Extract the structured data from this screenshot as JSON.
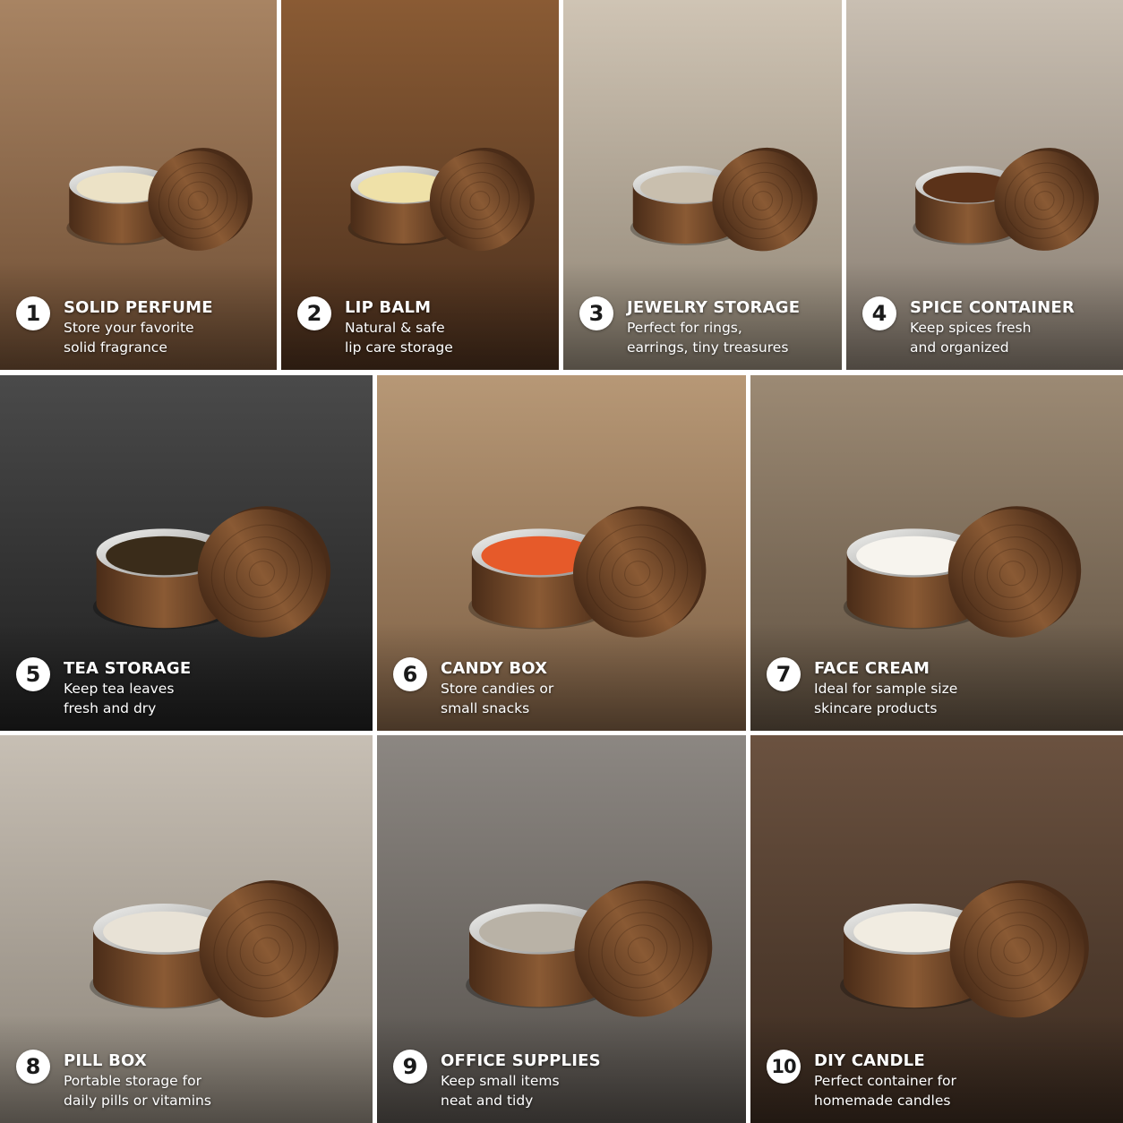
{
  "tiles": [
    {
      "number": "1",
      "title": "SOLID PERFUME",
      "line1": "Store your favorite",
      "line2": "solid fragrance",
      "colors": {
        "bg1": "#a88463",
        "bg2": "#6e4d33",
        "fill": "#ece2c6"
      }
    },
    {
      "number": "2",
      "title": "LIP BALM",
      "line1": "Natural & safe",
      "line2": "lip care storage",
      "colors": {
        "bg1": "#8a5b34",
        "bg2": "#4a2f1d",
        "fill": "#efe1a8"
      }
    },
    {
      "number": "3",
      "title": "JEWELRY STORAGE",
      "line1": "Perfect for rings,",
      "line2": "earrings, tiny treasures",
      "colors": {
        "bg1": "#cfc4b4",
        "bg2": "#8f8474",
        "fill": "#c9bfae"
      }
    },
    {
      "number": "4",
      "title": "SPICE CONTAINER",
      "line1": "Keep spices fresh",
      "line2": "and organized",
      "colors": {
        "bg1": "#c9bfb2",
        "bg2": "#857a6e",
        "fill": "#5b3219"
      }
    },
    {
      "number": "5",
      "title": "TEA STORAGE",
      "line1": "Keep tea leaves",
      "line2": "fresh and dry",
      "colors": {
        "bg1": "#4a4a4a",
        "bg2": "#1f1f1f",
        "fill": "#3a2c1a"
      }
    },
    {
      "number": "6",
      "title": "CANDY BOX",
      "line1": "Store candies or",
      "line2": "small snacks",
      "colors": {
        "bg1": "#b79876",
        "bg2": "#7c5e43",
        "fill": "#e65a2a"
      }
    },
    {
      "number": "7",
      "title": "FACE CREAM",
      "line1": "Ideal for sample size",
      "line2": "skincare products",
      "colors": {
        "bg1": "#9c8a74",
        "bg2": "#5f5040",
        "fill": "#f7f4ee"
      }
    },
    {
      "number": "8",
      "title": "PILL BOX",
      "line1": "Portable storage for",
      "line2": "daily pills or vitamins",
      "colors": {
        "bg1": "#c7bfb4",
        "bg2": "#8b8378",
        "fill": "#e8e2d6"
      }
    },
    {
      "number": "9",
      "title": "OFFICE SUPPLIES",
      "line1": "Keep small items",
      "line2": "neat and tidy",
      "colors": {
        "bg1": "#8c8782",
        "bg2": "#55504b",
        "fill": "#b9b2a6"
      }
    },
    {
      "number": "10",
      "title": "DIY CANDLE",
      "line1": "Perfect container for",
      "line2": "homemade candles",
      "colors": {
        "bg1": "#6b5240",
        "bg2": "#3a2a1f",
        "fill": "#f1ece1"
      }
    }
  ],
  "colors": {
    "wood_dark": "#4a2c18",
    "wood_mid": "#6b4023",
    "wood_light": "#8a5a34",
    "metal": "#c9c9c7",
    "metal_dark": "#8e8e8c"
  }
}
